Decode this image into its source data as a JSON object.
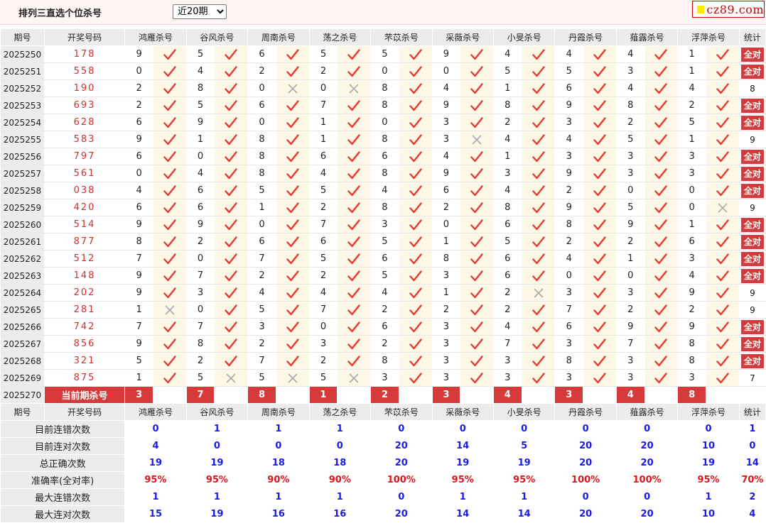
{
  "page_title": "排列三直选个位杀号",
  "period_select": {
    "value": "近20期"
  },
  "logo": {
    "text": "cz89.com"
  },
  "headers": [
    "期号",
    "开奖号码",
    "鸿雁杀号",
    "谷风杀号",
    "周南杀号",
    "荡之杀号",
    "芣苡杀号",
    "采薇杀号",
    "小旻杀号",
    "丹霞杀号",
    "薤露杀号",
    "浮萍杀号",
    "统计"
  ],
  "rows": [
    {
      "issue": "2025250",
      "draw": "178",
      "kills": [
        "9",
        "5",
        "6",
        "5",
        "5",
        "9",
        "4",
        "4",
        "4",
        "1"
      ],
      "marks": [
        "ok",
        "ok",
        "ok",
        "ok",
        "ok",
        "ok",
        "ok",
        "ok",
        "ok",
        "ok"
      ],
      "stat": "全对"
    },
    {
      "issue": "2025251",
      "draw": "558",
      "kills": [
        "0",
        "4",
        "2",
        "2",
        "0",
        "0",
        "5",
        "5",
        "3",
        "1"
      ],
      "marks": [
        "ok",
        "ok",
        "ok",
        "ok",
        "ok",
        "ok",
        "ok",
        "ok",
        "ok",
        "ok"
      ],
      "stat": "全对"
    },
    {
      "issue": "2025252",
      "draw": "190",
      "kills": [
        "2",
        "8",
        "0",
        "0",
        "8",
        "4",
        "1",
        "6",
        "4",
        "4"
      ],
      "marks": [
        "ok",
        "ok",
        "no",
        "no",
        "ok",
        "ok",
        "ok",
        "ok",
        "ok",
        "ok"
      ],
      "stat": "8"
    },
    {
      "issue": "2025253",
      "draw": "693",
      "kills": [
        "2",
        "5",
        "6",
        "7",
        "8",
        "9",
        "8",
        "9",
        "8",
        "2"
      ],
      "marks": [
        "ok",
        "ok",
        "ok",
        "ok",
        "ok",
        "ok",
        "ok",
        "ok",
        "ok",
        "ok"
      ],
      "stat": "全对"
    },
    {
      "issue": "2025254",
      "draw": "628",
      "kills": [
        "6",
        "9",
        "0",
        "1",
        "0",
        "3",
        "2",
        "3",
        "2",
        "5"
      ],
      "marks": [
        "ok",
        "ok",
        "ok",
        "ok",
        "ok",
        "ok",
        "ok",
        "ok",
        "ok",
        "ok"
      ],
      "stat": "全对"
    },
    {
      "issue": "2025255",
      "draw": "583",
      "kills": [
        "9",
        "1",
        "8",
        "1",
        "8",
        "3",
        "4",
        "4",
        "5",
        "1"
      ],
      "marks": [
        "ok",
        "ok",
        "ok",
        "ok",
        "ok",
        "no",
        "ok",
        "ok",
        "ok",
        "ok"
      ],
      "stat": "9"
    },
    {
      "issue": "2025256",
      "draw": "797",
      "kills": [
        "6",
        "0",
        "8",
        "6",
        "6",
        "4",
        "1",
        "3",
        "3",
        "3"
      ],
      "marks": [
        "ok",
        "ok",
        "ok",
        "ok",
        "ok",
        "ok",
        "ok",
        "ok",
        "ok",
        "ok"
      ],
      "stat": "全对"
    },
    {
      "issue": "2025257",
      "draw": "561",
      "kills": [
        "0",
        "4",
        "8",
        "4",
        "8",
        "9",
        "3",
        "9",
        "3",
        "3"
      ],
      "marks": [
        "ok",
        "ok",
        "ok",
        "ok",
        "ok",
        "ok",
        "ok",
        "ok",
        "ok",
        "ok"
      ],
      "stat": "全对"
    },
    {
      "issue": "2025258",
      "draw": "038",
      "kills": [
        "4",
        "6",
        "5",
        "5",
        "4",
        "6",
        "4",
        "2",
        "0",
        "0"
      ],
      "marks": [
        "ok",
        "ok",
        "ok",
        "ok",
        "ok",
        "ok",
        "ok",
        "ok",
        "ok",
        "ok"
      ],
      "stat": "全对"
    },
    {
      "issue": "2025259",
      "draw": "420",
      "kills": [
        "6",
        "6",
        "1",
        "2",
        "8",
        "2",
        "8",
        "9",
        "5",
        "0"
      ],
      "marks": [
        "ok",
        "ok",
        "ok",
        "ok",
        "ok",
        "ok",
        "ok",
        "ok",
        "ok",
        "no"
      ],
      "stat": "9"
    },
    {
      "issue": "2025260",
      "draw": "514",
      "kills": [
        "9",
        "9",
        "0",
        "7",
        "3",
        "0",
        "6",
        "8",
        "9",
        "1"
      ],
      "marks": [
        "ok",
        "ok",
        "ok",
        "ok",
        "ok",
        "ok",
        "ok",
        "ok",
        "ok",
        "ok"
      ],
      "stat": "全对"
    },
    {
      "issue": "2025261",
      "draw": "877",
      "kills": [
        "8",
        "2",
        "6",
        "6",
        "5",
        "1",
        "5",
        "2",
        "2",
        "6"
      ],
      "marks": [
        "ok",
        "ok",
        "ok",
        "ok",
        "ok",
        "ok",
        "ok",
        "ok",
        "ok",
        "ok"
      ],
      "stat": "全对"
    },
    {
      "issue": "2025262",
      "draw": "512",
      "kills": [
        "7",
        "0",
        "7",
        "5",
        "6",
        "8",
        "6",
        "4",
        "1",
        "3"
      ],
      "marks": [
        "ok",
        "ok",
        "ok",
        "ok",
        "ok",
        "ok",
        "ok",
        "ok",
        "ok",
        "ok"
      ],
      "stat": "全对"
    },
    {
      "issue": "2025263",
      "draw": "148",
      "kills": [
        "9",
        "7",
        "2",
        "2",
        "5",
        "3",
        "6",
        "0",
        "0",
        "4"
      ],
      "marks": [
        "ok",
        "ok",
        "ok",
        "ok",
        "ok",
        "ok",
        "ok",
        "ok",
        "ok",
        "ok"
      ],
      "stat": "全对"
    },
    {
      "issue": "2025264",
      "draw": "202",
      "kills": [
        "9",
        "3",
        "4",
        "4",
        "4",
        "1",
        "2",
        "3",
        "3",
        "9"
      ],
      "marks": [
        "ok",
        "ok",
        "ok",
        "ok",
        "ok",
        "ok",
        "no",
        "ok",
        "ok",
        "ok"
      ],
      "stat": "9"
    },
    {
      "issue": "2025265",
      "draw": "281",
      "kills": [
        "1",
        "0",
        "5",
        "7",
        "2",
        "2",
        "2",
        "7",
        "2",
        "2"
      ],
      "marks": [
        "no",
        "ok",
        "ok",
        "ok",
        "ok",
        "ok",
        "ok",
        "ok",
        "ok",
        "ok"
      ],
      "stat": "9"
    },
    {
      "issue": "2025266",
      "draw": "742",
      "kills": [
        "7",
        "7",
        "3",
        "0",
        "6",
        "3",
        "4",
        "6",
        "9",
        "9"
      ],
      "marks": [
        "ok",
        "ok",
        "ok",
        "ok",
        "ok",
        "ok",
        "ok",
        "ok",
        "ok",
        "ok"
      ],
      "stat": "全对"
    },
    {
      "issue": "2025267",
      "draw": "856",
      "kills": [
        "9",
        "8",
        "2",
        "3",
        "2",
        "3",
        "7",
        "3",
        "7",
        "8"
      ],
      "marks": [
        "ok",
        "ok",
        "ok",
        "ok",
        "ok",
        "ok",
        "ok",
        "ok",
        "ok",
        "ok"
      ],
      "stat": "全对"
    },
    {
      "issue": "2025268",
      "draw": "321",
      "kills": [
        "5",
        "2",
        "7",
        "2",
        "8",
        "3",
        "3",
        "8",
        "3",
        "8"
      ],
      "marks": [
        "ok",
        "ok",
        "ok",
        "ok",
        "ok",
        "ok",
        "ok",
        "ok",
        "ok",
        "ok"
      ],
      "stat": "全对"
    },
    {
      "issue": "2025269",
      "draw": "875",
      "kills": [
        "1",
        "5",
        "5",
        "5",
        "3",
        "3",
        "3",
        "3",
        "3",
        "3"
      ],
      "marks": [
        "ok",
        "no",
        "no",
        "no",
        "ok",
        "ok",
        "ok",
        "ok",
        "ok",
        "ok"
      ],
      "stat": "7"
    }
  ],
  "current": {
    "issue": "2025270",
    "label": "当前期杀号",
    "kills": [
      "3",
      "7",
      "8",
      "1",
      "2",
      "3",
      "4",
      "3",
      "4",
      "8"
    ]
  },
  "summary": [
    {
      "label": "目前连错次数",
      "values": [
        "0",
        "1",
        "1",
        "1",
        "0",
        "0",
        "0",
        "0",
        "0",
        "0",
        "1"
      ]
    },
    {
      "label": "目前连对次数",
      "values": [
        "4",
        "0",
        "0",
        "0",
        "20",
        "14",
        "5",
        "20",
        "20",
        "10",
        "0"
      ]
    },
    {
      "label": "总正确次数",
      "values": [
        "19",
        "19",
        "18",
        "18",
        "20",
        "19",
        "19",
        "20",
        "20",
        "19",
        "14"
      ]
    },
    {
      "label": "准确率(全对率)",
      "values": [
        "95%",
        "95%",
        "90%",
        "90%",
        "100%",
        "95%",
        "95%",
        "100%",
        "100%",
        "95%",
        "70%"
      ],
      "highlight": true
    },
    {
      "label": "最大连错次数",
      "values": [
        "1",
        "1",
        "1",
        "1",
        "0",
        "1",
        "1",
        "0",
        "0",
        "1",
        "2"
      ]
    },
    {
      "label": "最大连对次数",
      "values": [
        "15",
        "19",
        "16",
        "16",
        "20",
        "14",
        "14",
        "20",
        "20",
        "10",
        "4"
      ]
    }
  ],
  "colors": {
    "accent": "#d63a3a",
    "blue": "#1a1ae6",
    "header_bg": "#ececec",
    "mark_bg": "#fdf8e6"
  }
}
